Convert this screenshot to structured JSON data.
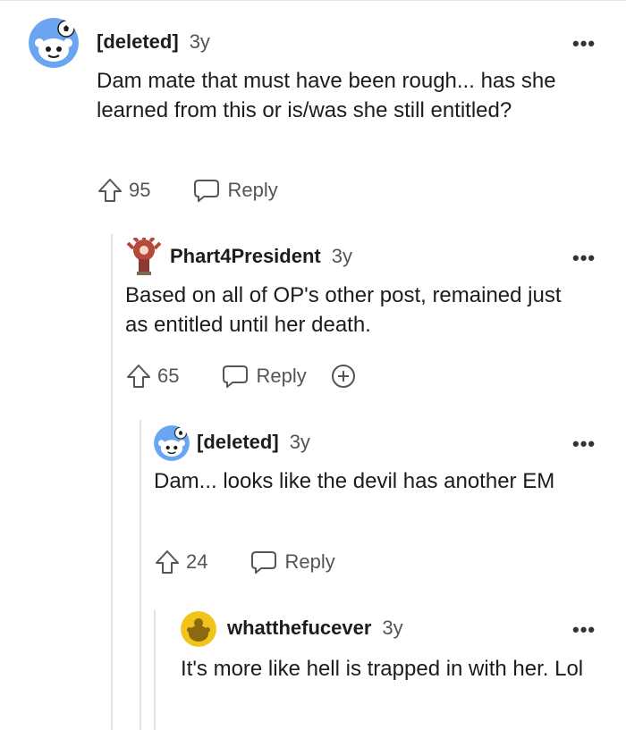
{
  "comments": [
    {
      "username": "[deleted]",
      "age": "3y",
      "text": "Dam mate that must have been rough... has she learned from this or is/was she still entitled?",
      "votes": "95",
      "reply_label": "Reply",
      "avatar_icon": "snoo-soccer-avatar-icon"
    },
    {
      "username": "Phart4President",
      "age": "3y",
      "text": "Based on all of OP's other post, remained just as entitled until her death.",
      "votes": "65",
      "reply_label": "Reply",
      "avatar_icon": "demogorgon-avatar-icon"
    },
    {
      "username": "[deleted]",
      "age": "3y",
      "text": "Dam... looks like the devil has another EM",
      "votes": "24",
      "reply_label": "Reply",
      "avatar_icon": "snoo-soccer-avatar-icon"
    },
    {
      "username": "whatthefucever",
      "age": "3y",
      "text": "It's more like hell is trapped in with her. Lol",
      "avatar_icon": "snoo-yellow-avatar-icon"
    }
  ],
  "more_label": "•••",
  "colors": {
    "text": "#1c1c1c",
    "muted": "#555555",
    "threadline": "#e3e3e3",
    "avatar_blue": "#6ba4f0",
    "avatar_yellow": "#f0c419"
  }
}
